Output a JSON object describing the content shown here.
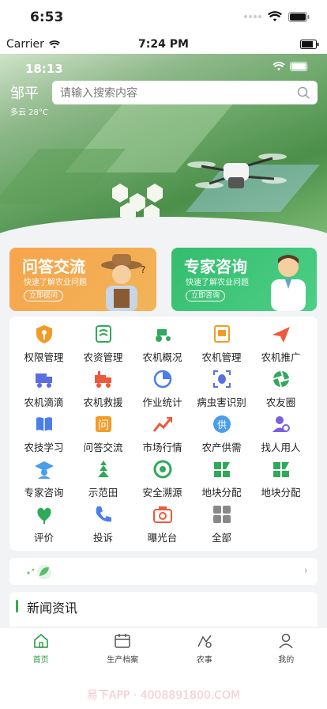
{
  "os_status": {
    "time": "6:53"
  },
  "simulator_bar": {
    "carrier": "Carrier",
    "time": "7:24 PM"
  },
  "app_status": {
    "time": "18:13"
  },
  "location": {
    "city": "邹平",
    "weather": "多云 28°C"
  },
  "search": {
    "placeholder": "请输入搜索内容"
  },
  "promo_cards": [
    {
      "title": "问答交流",
      "subtitle": "快速了解农业问题",
      "button": "立即提问",
      "color": "#f6a44c"
    },
    {
      "title": "专家咨询",
      "subtitle": "快速了解农业问题",
      "button": "立即咨询",
      "color": "#34bd6e"
    }
  ],
  "grid_items": [
    {
      "label": "权限管理",
      "icon": "key-shield-icon",
      "color": "#f29b28"
    },
    {
      "label": "农资管理",
      "icon": "grain-bag-icon",
      "color": "#2fa95a"
    },
    {
      "label": "农机概况",
      "icon": "tractor-icon",
      "color": "#2fa95a"
    },
    {
      "label": "农机管理",
      "icon": "monitor-icon",
      "color": "#f29b28"
    },
    {
      "label": "农机推广",
      "icon": "paper-plane-icon",
      "color": "#ec5a3b"
    },
    {
      "label": "农机滴滴",
      "icon": "truck-icon",
      "color": "#5a6fe0"
    },
    {
      "label": "农机救援",
      "icon": "rescue-truck-icon",
      "color": "#ec5a3b"
    },
    {
      "label": "作业统计",
      "icon": "pie-chart-icon",
      "color": "#4a7ee8"
    },
    {
      "label": "病虫害识别",
      "icon": "bug-scan-icon",
      "color": "#5a6fe0"
    },
    {
      "label": "农友圈",
      "icon": "aperture-icon",
      "color": "#2fa95a"
    },
    {
      "label": "农技学习",
      "icon": "book-icon",
      "color": "#4a7ee8"
    },
    {
      "label": "问答交流",
      "icon": "question-chat-icon",
      "color": "#f29b28"
    },
    {
      "label": "市场行情",
      "icon": "trend-chart-icon",
      "color": "#ec5a3b"
    },
    {
      "label": "农产供需",
      "icon": "supply-badge-icon",
      "color": "#4a9de8"
    },
    {
      "label": "找人用人",
      "icon": "find-person-icon",
      "color": "#7a5fe0"
    },
    {
      "label": "专家咨询",
      "icon": "expert-cap-icon",
      "color": "#4a9de8"
    },
    {
      "label": "示范田",
      "icon": "field-icon",
      "color": "#2fa95a"
    },
    {
      "label": "安全溯源",
      "icon": "trace-icon",
      "color": "#2fa95a"
    },
    {
      "label": "地块分配",
      "icon": "plot-allocate-icon",
      "color": "#2fa95a"
    },
    {
      "label": "地块分配",
      "icon": "plot-allocate-icon",
      "color": "#2fa95a"
    },
    {
      "label": "评价",
      "icon": "heart-leaf-icon",
      "color": "#2fa95a"
    },
    {
      "label": "投诉",
      "icon": "phone-icon",
      "color": "#4a7ee8"
    },
    {
      "label": "曝光台",
      "icon": "camera-icon",
      "color": "#ec5a3b"
    },
    {
      "label": "全部",
      "icon": "grid-all-icon",
      "color": "#888888"
    }
  ],
  "news": {
    "title": "新闻资讯"
  },
  "tabbar": [
    {
      "label": "首页",
      "icon": "home-icon",
      "active": true
    },
    {
      "label": "生产档案",
      "icon": "calendar-icon",
      "active": false
    },
    {
      "label": "农事",
      "icon": "farm-work-icon",
      "active": false
    },
    {
      "label": "我的",
      "icon": "user-icon",
      "active": false
    }
  ],
  "watermark": "易下APP · 4008891800.COM",
  "colors": {
    "brand_green": "#2e9c45",
    "accent_orange": "#f6a44c"
  }
}
